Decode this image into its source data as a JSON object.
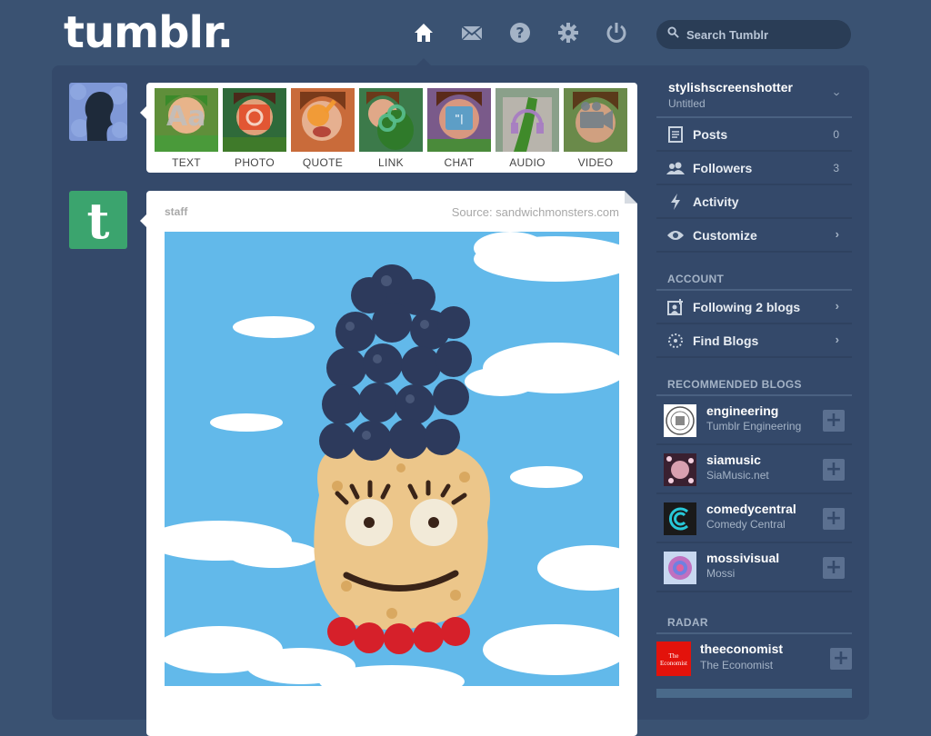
{
  "brand": {
    "logo_text": "tumblr."
  },
  "nav": {
    "icons": [
      "home-icon",
      "mail-icon",
      "help-icon",
      "settings-icon",
      "power-icon"
    ]
  },
  "search": {
    "placeholder": "Search Tumblr"
  },
  "post_types": [
    {
      "label": "TEXT",
      "icon": "text-icon",
      "color": "#b0b0b0"
    },
    {
      "label": "PHOTO",
      "icon": "camera-icon",
      "color": "#e24e2b"
    },
    {
      "label": "QUOTE",
      "icon": "quote-icon",
      "color": "#f2992e"
    },
    {
      "label": "LINK",
      "icon": "link-icon",
      "color": "#56bc8a"
    },
    {
      "label": "CHAT",
      "icon": "chat-icon",
      "color": "#529ecc"
    },
    {
      "label": "AUDIO",
      "icon": "headphones-icon",
      "color": "#a77dc2"
    },
    {
      "label": "VIDEO",
      "icon": "video-icon",
      "color": "#748089"
    }
  ],
  "post": {
    "author": "staff",
    "source": "Source: sandwichmonsters.com"
  },
  "sidebar": {
    "blog": {
      "name": "stylishscreenshotter",
      "title": "Untitled"
    },
    "items": [
      {
        "label": "Posts",
        "count": "0",
        "icon": "posts-icon"
      },
      {
        "label": "Followers",
        "count": "3",
        "icon": "followers-icon"
      },
      {
        "label": "Activity",
        "count": "",
        "icon": "activity-icon"
      },
      {
        "label": "Customize",
        "count": "",
        "icon": "eye-icon"
      }
    ],
    "account_title": "ACCOUNT",
    "account_items": [
      {
        "label": "Following 2 blogs",
        "icon": "following-icon"
      },
      {
        "label": "Find Blogs",
        "icon": "find-blogs-icon"
      }
    ],
    "recommended_title": "RECOMMENDED BLOGS",
    "recommended": [
      {
        "name": "engineering",
        "sub": "Tumblr Engineering"
      },
      {
        "name": "siamusic",
        "sub": "SiaMusic.net"
      },
      {
        "name": "comedycentral",
        "sub": "Comedy Central"
      },
      {
        "name": "mossivisual",
        "sub": "Mossi"
      }
    ],
    "radar_title": "RADAR",
    "radar": {
      "name": "theeconomist",
      "sub": "The Economist",
      "thumb_text": "The Economist"
    }
  },
  "colors": {
    "background": "#3a5272",
    "panel": "#34496a",
    "tumblr_green": "#3ba46e",
    "economist_red": "#e3120b"
  }
}
